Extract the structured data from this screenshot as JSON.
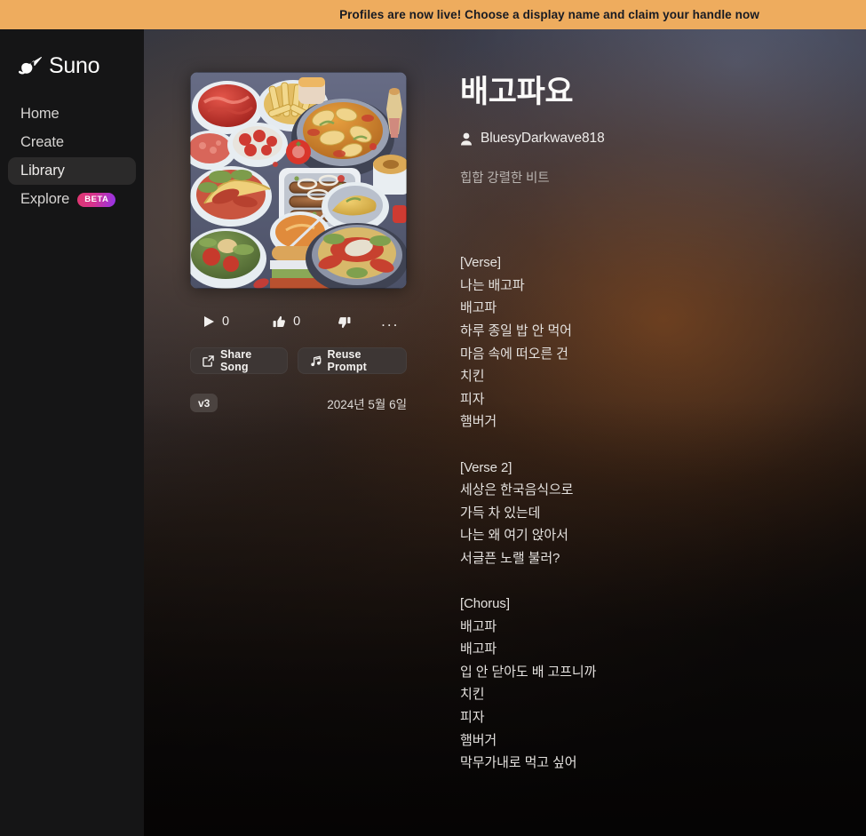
{
  "banner": {
    "text": "Profiles are now live! Choose a display name and claim your handle now",
    "bg_color": "#eeac5e",
    "text_color": "#171a23"
  },
  "sidebar": {
    "brand": "Suno",
    "logo_icon": "suno-note-logo-icon",
    "items": [
      {
        "label": "Home",
        "active": false
      },
      {
        "label": "Create",
        "active": false
      },
      {
        "label": "Library",
        "active": true
      },
      {
        "label": "Explore",
        "active": false,
        "badge": "BETA"
      }
    ],
    "badge_gradient": [
      "#e0376f",
      "#9333ea"
    ],
    "active_bg": "#2b2a2a"
  },
  "song": {
    "title": "배고파요",
    "author": "BluesyDarkwave818",
    "author_icon": "person-icon",
    "style_tags": "힙합 강렬한 비트",
    "version": "v3",
    "date": "2024년 5월 6일",
    "artwork_alt": "illustration of many bowls and plates of food on a blue-grey table"
  },
  "stats": {
    "play_icon": "play-icon",
    "play_count": "0",
    "like_icon": "thumbs-up-icon",
    "like_count": "0",
    "dislike_icon": "thumbs-down-icon",
    "more_icon": "ellipsis-icon",
    "more_label": "..."
  },
  "actions": {
    "share": {
      "label": "Share Song",
      "icon": "share-icon"
    },
    "reuse": {
      "label": "Reuse Prompt",
      "icon": "music-note-icon"
    }
  },
  "lyrics": "[Verse]\n나는 배고파\n배고파\n하루 종일 밥 안 먹어\n마음 속에 떠오른 건\n치킨\n피자\n햄버거\n\n[Verse 2]\n세상은 한국음식으로\n가득 차 있는데\n나는 왜 여기 앉아서\n서글픈 노랠 불러?\n\n[Chorus]\n배고파\n배고파\n입 안 닫아도 배 고프니까\n치킨\n피자\n햄버거\n막무가내로 먹고 싶어"
}
